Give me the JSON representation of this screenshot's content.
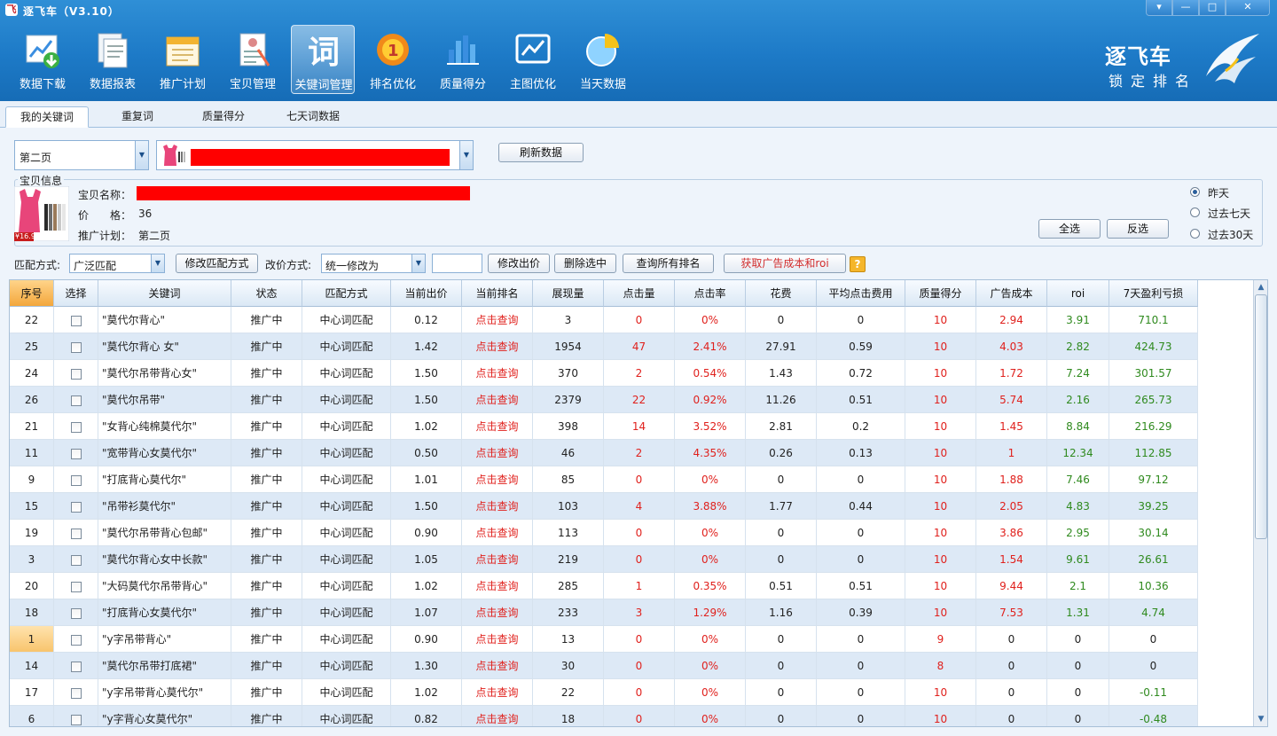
{
  "window": {
    "title": "逐飞车（V3.10）"
  },
  "toolbar": [
    {
      "label": "数据下载",
      "icon": "chart-download-icon"
    },
    {
      "label": "数据报表",
      "icon": "report-icon"
    },
    {
      "label": "推广计划",
      "icon": "calendar-icon"
    },
    {
      "label": "宝贝管理",
      "icon": "product-list-icon"
    },
    {
      "label": "关键词管理",
      "icon": "keyword-icon"
    },
    {
      "label": "排名优化",
      "icon": "rank-badge-icon"
    },
    {
      "label": "质量得分",
      "icon": "bar-chart-icon"
    },
    {
      "label": "主图优化",
      "icon": "image-chart-icon"
    },
    {
      "label": "当天数据",
      "icon": "pie-chart-icon"
    }
  ],
  "brand": {
    "name": "逐飞车",
    "tagline": "锁定排名"
  },
  "tabs": [
    "我的关键词",
    "重复词",
    "质量得分",
    "七天词数据"
  ],
  "panel": {
    "plan_select": "第二页",
    "refresh_label": "刷新数据",
    "info_group_title": "宝贝信息",
    "name_label": "宝贝名称：",
    "price_label": "价　　格：",
    "price_value": "36",
    "plan_label": "推广计划：",
    "plan_value": "第二页",
    "ranges": [
      "昨天",
      "过去七天",
      "过去30天"
    ],
    "select_all": "全选",
    "invert_select": "反选",
    "thumb_price_tag": "¥16.90",
    "redaction_color": "#ff0000"
  },
  "actions": {
    "match_label": "匹配方式:",
    "match_value": "广泛匹配",
    "modify_match": "修改匹配方式",
    "price_mode_label": "改价方式:",
    "price_mode_value": "统一修改为",
    "price_input": "",
    "modify_bid": "修改出价",
    "delete_selected": "删除选中",
    "query_ranks": "查询所有排名",
    "get_roi": "获取广告成本和roi",
    "help_icon": "?"
  },
  "grid": {
    "headers": [
      "序号",
      "选择",
      "关键词",
      "状态",
      "匹配方式",
      "当前出价",
      "当前排名",
      "展现量",
      "点击量",
      "点击率",
      "花费",
      "平均点击费用",
      "质量得分",
      "广告成本",
      "roi",
      "7天盈利亏损"
    ],
    "rows": [
      [
        "22",
        "",
        "\"莫代尔背心\"",
        "推广中",
        "中心词匹配",
        "0.12",
        "点击查询",
        "3",
        "0",
        "0%",
        "0",
        "0",
        "10",
        "2.94",
        "3.91",
        "710.1"
      ],
      [
        "25",
        "",
        "\"莫代尔背心 女\"",
        "推广中",
        "中心词匹配",
        "1.42",
        "点击查询",
        "1954",
        "47",
        "2.41%",
        "27.91",
        "0.59",
        "10",
        "4.03",
        "2.82",
        "424.73"
      ],
      [
        "24",
        "",
        "\"莫代尔吊带背心女\"",
        "推广中",
        "中心词匹配",
        "1.50",
        "点击查询",
        "370",
        "2",
        "0.54%",
        "1.43",
        "0.72",
        "10",
        "1.72",
        "7.24",
        "301.57"
      ],
      [
        "26",
        "",
        "\"莫代尔吊带\"",
        "推广中",
        "中心词匹配",
        "1.50",
        "点击查询",
        "2379",
        "22",
        "0.92%",
        "11.26",
        "0.51",
        "10",
        "5.74",
        "2.16",
        "265.73"
      ],
      [
        "21",
        "",
        "\"女背心纯棉莫代尔\"",
        "推广中",
        "中心词匹配",
        "1.02",
        "点击查询",
        "398",
        "14",
        "3.52%",
        "2.81",
        "0.2",
        "10",
        "1.45",
        "8.84",
        "216.29"
      ],
      [
        "11",
        "",
        "\"宽带背心女莫代尔\"",
        "推广中",
        "中心词匹配",
        "0.50",
        "点击查询",
        "46",
        "2",
        "4.35%",
        "0.26",
        "0.13",
        "10",
        "1",
        "12.34",
        "112.85"
      ],
      [
        "9",
        "",
        "\"打底背心莫代尔\"",
        "推广中",
        "中心词匹配",
        "1.01",
        "点击查询",
        "85",
        "0",
        "0%",
        "0",
        "0",
        "10",
        "1.88",
        "7.46",
        "97.12"
      ],
      [
        "15",
        "",
        "\"吊带衫莫代尔\"",
        "推广中",
        "中心词匹配",
        "1.50",
        "点击查询",
        "103",
        "4",
        "3.88%",
        "1.77",
        "0.44",
        "10",
        "2.05",
        "4.83",
        "39.25"
      ],
      [
        "19",
        "",
        "\"莫代尔吊带背心包邮\"",
        "推广中",
        "中心词匹配",
        "0.90",
        "点击查询",
        "113",
        "0",
        "0%",
        "0",
        "0",
        "10",
        "3.86",
        "2.95",
        "30.14"
      ],
      [
        "3",
        "",
        "\"莫代尔背心女中长款\"",
        "推广中",
        "中心词匹配",
        "1.05",
        "点击查询",
        "219",
        "0",
        "0%",
        "0",
        "0",
        "10",
        "1.54",
        "9.61",
        "26.61"
      ],
      [
        "20",
        "",
        "\"大码莫代尔吊带背心\"",
        "推广中",
        "中心词匹配",
        "1.02",
        "点击查询",
        "285",
        "1",
        "0.35%",
        "0.51",
        "0.51",
        "10",
        "9.44",
        "2.1",
        "10.36"
      ],
      [
        "18",
        "",
        "\"打底背心女莫代尔\"",
        "推广中",
        "中心词匹配",
        "1.07",
        "点击查询",
        "233",
        "3",
        "1.29%",
        "1.16",
        "0.39",
        "10",
        "7.53",
        "1.31",
        "4.74"
      ],
      [
        "1",
        "",
        "\"y字吊带背心\"",
        "推广中",
        "中心词匹配",
        "0.90",
        "点击查询",
        "13",
        "0",
        "0%",
        "0",
        "0",
        "9",
        "0",
        "0",
        "0"
      ],
      [
        "14",
        "",
        "\"莫代尔吊带打底裙\"",
        "推广中",
        "中心词匹配",
        "1.30",
        "点击查询",
        "30",
        "0",
        "0%",
        "0",
        "0",
        "8",
        "0",
        "0",
        "0"
      ],
      [
        "17",
        "",
        "\"y字吊带背心莫代尔\"",
        "推广中",
        "中心词匹配",
        "1.02",
        "点击查询",
        "22",
        "0",
        "0%",
        "0",
        "0",
        "10",
        "0",
        "0",
        "-0.11"
      ],
      [
        "6",
        "",
        "\"y字背心女莫代尔\"",
        "推广中",
        "中心词匹配",
        "0.82",
        "点击查询",
        "18",
        "0",
        "0%",
        "0",
        "0",
        "10",
        "0",
        "0",
        "-0.48"
      ]
    ],
    "selected_row_index": 12
  },
  "colors": {
    "accent_red": "#e0211d",
    "accent_green": "#2f8a1e",
    "header_blue": "#1d7ac7",
    "alt_row": "#dde9f6"
  }
}
